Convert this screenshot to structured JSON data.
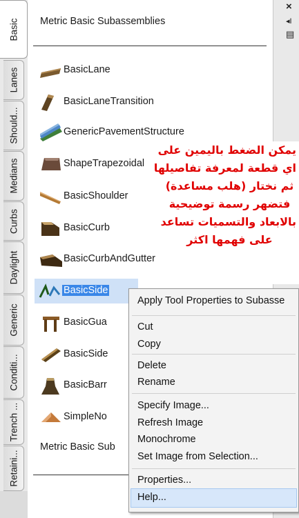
{
  "tabs": [
    "Basic",
    "Lanes",
    "Should...",
    "Medians",
    "Curbs",
    "Daylight",
    "Generic",
    "Conditi...",
    "Trench ...",
    "Retaini..."
  ],
  "palette": {
    "title": "Metric Basic Subassemblies",
    "footer_title": "Metric Basic Sub",
    "tools": [
      {
        "label": "BasicLane",
        "icon": "lane-icon"
      },
      {
        "label": "BasicLaneTransition",
        "icon": "lane-transition-icon"
      },
      {
        "label": "GenericPavementStructure",
        "icon": "pavement-structure-icon"
      },
      {
        "label": "ShapeTrapezoidal",
        "icon": "trapezoid-icon"
      },
      {
        "label": "BasicShoulder",
        "icon": "shoulder-icon"
      },
      {
        "label": "BasicCurb",
        "icon": "curb-icon"
      },
      {
        "label": "BasicCurbAndGutter",
        "icon": "curb-gutter-icon"
      },
      {
        "label": "BasicSide",
        "icon": "sidewalk-icon"
      },
      {
        "label": "BasicGua",
        "icon": "guardrail-icon"
      },
      {
        "label": "BasicSide",
        "icon": "side-slope-icon"
      },
      {
        "label": "BasicBarr",
        "icon": "barrier-icon"
      },
      {
        "label": "SimpleNo",
        "icon": "simple-node-icon"
      }
    ]
  },
  "right_toolbar": {
    "close": "×",
    "autohide": "◂I",
    "properties": "▤"
  },
  "annotation": {
    "lines": [
      "يمكن الضغط باليمين على",
      "اي قطعة لمعرفة تفاصيلها",
      "ثم نختار (هلب مساعدة)",
      "فتضهر رسمة توضيحية",
      "بالابعاد والتسميات تساعد",
      "على فهمها اكثر"
    ],
    "color": "#e00000"
  },
  "context_menu": {
    "items": [
      "Apply Tool Properties to Subasse",
      "Cut",
      "Copy",
      "Delete",
      "Rename",
      "Specify Image...",
      "Refresh Image",
      "Monochrome",
      "Set Image from Selection...",
      "Properties...",
      "Help..."
    ]
  }
}
